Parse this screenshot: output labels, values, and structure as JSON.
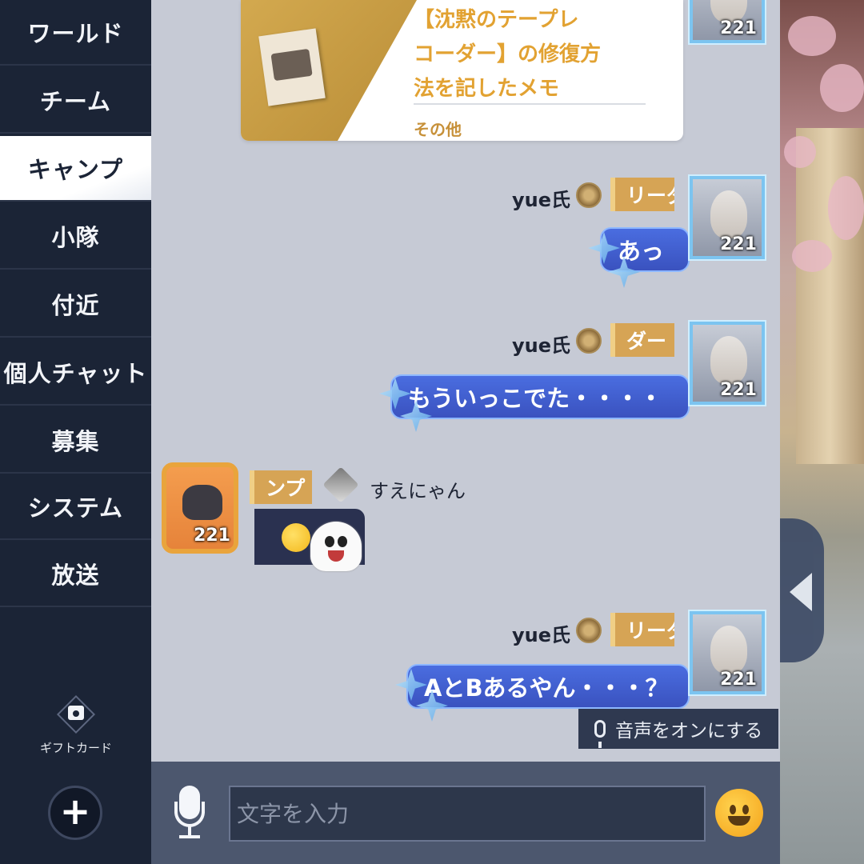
{
  "sidebar": {
    "items": [
      {
        "label": "ワールド"
      },
      {
        "label": "チーム"
      },
      {
        "label": "キャンプ",
        "active": true
      },
      {
        "label": "小隊"
      },
      {
        "label": "付近"
      },
      {
        "label": "個人チャット"
      },
      {
        "label": "募集"
      },
      {
        "label": "システム"
      },
      {
        "label": "放送"
      }
    ],
    "gift_card_label": "ギフトカード",
    "add_icon": "plus-icon"
  },
  "item_card": {
    "title_line1": "【沈黙のテープレ",
    "title_line2": "コーダー】の修復方",
    "title_line3": "法を記したメモ",
    "category": "その他",
    "avatar_level": "221"
  },
  "messages": [
    {
      "sender": "yue氏",
      "tag": "リーダ",
      "text": "あっ",
      "level": "221"
    },
    {
      "sender": "yue氏",
      "tag": "ダー",
      "text": "もういっこでた・・・・",
      "level": "221"
    },
    {
      "sender": "すえにゃん",
      "tag": "ンプ",
      "sticker": "ghost-sticker",
      "level": "221"
    },
    {
      "sender": "yue氏",
      "tag": "リーダ",
      "text": "AとBあるやん・・・？",
      "level": "221"
    }
  ],
  "voice_toggle": {
    "label": "音声をオンにする"
  },
  "input": {
    "placeholder": "文字を入力"
  },
  "colors": {
    "sidebar_bg": "#1b2436",
    "chat_bg": "#c6cad5",
    "bubble": "#3f5cd0",
    "tag": "#d6a455",
    "item_title": "#e2a232"
  }
}
